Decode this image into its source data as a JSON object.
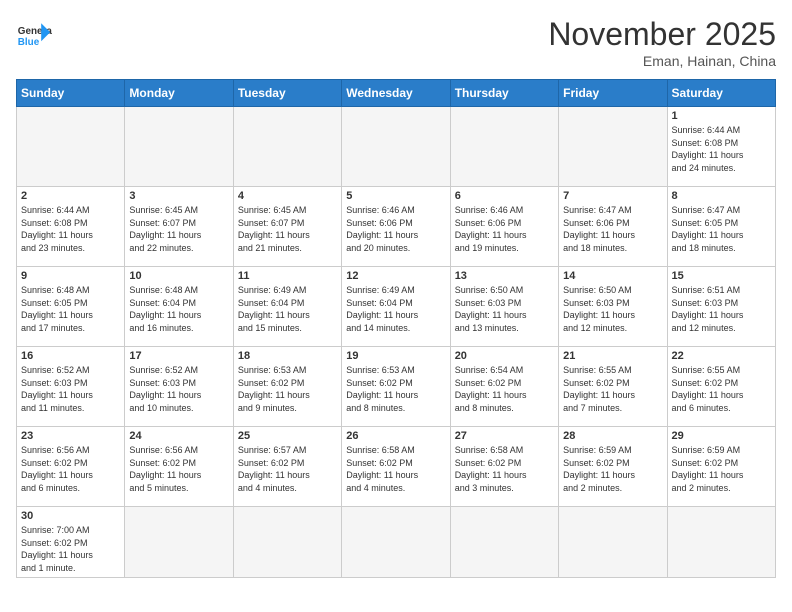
{
  "header": {
    "logo_general": "General",
    "logo_blue": "Blue",
    "month_title": "November 2025",
    "location": "Eman, Hainan, China"
  },
  "weekdays": [
    "Sunday",
    "Monday",
    "Tuesday",
    "Wednesday",
    "Thursday",
    "Friday",
    "Saturday"
  ],
  "weeks": [
    [
      {
        "day": "",
        "info": ""
      },
      {
        "day": "",
        "info": ""
      },
      {
        "day": "",
        "info": ""
      },
      {
        "day": "",
        "info": ""
      },
      {
        "day": "",
        "info": ""
      },
      {
        "day": "",
        "info": ""
      },
      {
        "day": "1",
        "info": "Sunrise: 6:44 AM\nSunset: 6:08 PM\nDaylight: 11 hours\nand 24 minutes."
      }
    ],
    [
      {
        "day": "2",
        "info": "Sunrise: 6:44 AM\nSunset: 6:08 PM\nDaylight: 11 hours\nand 23 minutes."
      },
      {
        "day": "3",
        "info": "Sunrise: 6:45 AM\nSunset: 6:07 PM\nDaylight: 11 hours\nand 22 minutes."
      },
      {
        "day": "4",
        "info": "Sunrise: 6:45 AM\nSunset: 6:07 PM\nDaylight: 11 hours\nand 21 minutes."
      },
      {
        "day": "5",
        "info": "Sunrise: 6:46 AM\nSunset: 6:06 PM\nDaylight: 11 hours\nand 20 minutes."
      },
      {
        "day": "6",
        "info": "Sunrise: 6:46 AM\nSunset: 6:06 PM\nDaylight: 11 hours\nand 19 minutes."
      },
      {
        "day": "7",
        "info": "Sunrise: 6:47 AM\nSunset: 6:06 PM\nDaylight: 11 hours\nand 18 minutes."
      },
      {
        "day": "8",
        "info": "Sunrise: 6:47 AM\nSunset: 6:05 PM\nDaylight: 11 hours\nand 18 minutes."
      }
    ],
    [
      {
        "day": "9",
        "info": "Sunrise: 6:48 AM\nSunset: 6:05 PM\nDaylight: 11 hours\nand 17 minutes."
      },
      {
        "day": "10",
        "info": "Sunrise: 6:48 AM\nSunset: 6:04 PM\nDaylight: 11 hours\nand 16 minutes."
      },
      {
        "day": "11",
        "info": "Sunrise: 6:49 AM\nSunset: 6:04 PM\nDaylight: 11 hours\nand 15 minutes."
      },
      {
        "day": "12",
        "info": "Sunrise: 6:49 AM\nSunset: 6:04 PM\nDaylight: 11 hours\nand 14 minutes."
      },
      {
        "day": "13",
        "info": "Sunrise: 6:50 AM\nSunset: 6:03 PM\nDaylight: 11 hours\nand 13 minutes."
      },
      {
        "day": "14",
        "info": "Sunrise: 6:50 AM\nSunset: 6:03 PM\nDaylight: 11 hours\nand 12 minutes."
      },
      {
        "day": "15",
        "info": "Sunrise: 6:51 AM\nSunset: 6:03 PM\nDaylight: 11 hours\nand 12 minutes."
      }
    ],
    [
      {
        "day": "16",
        "info": "Sunrise: 6:52 AM\nSunset: 6:03 PM\nDaylight: 11 hours\nand 11 minutes."
      },
      {
        "day": "17",
        "info": "Sunrise: 6:52 AM\nSunset: 6:03 PM\nDaylight: 11 hours\nand 10 minutes."
      },
      {
        "day": "18",
        "info": "Sunrise: 6:53 AM\nSunset: 6:02 PM\nDaylight: 11 hours\nand 9 minutes."
      },
      {
        "day": "19",
        "info": "Sunrise: 6:53 AM\nSunset: 6:02 PM\nDaylight: 11 hours\nand 8 minutes."
      },
      {
        "day": "20",
        "info": "Sunrise: 6:54 AM\nSunset: 6:02 PM\nDaylight: 11 hours\nand 8 minutes."
      },
      {
        "day": "21",
        "info": "Sunrise: 6:55 AM\nSunset: 6:02 PM\nDaylight: 11 hours\nand 7 minutes."
      },
      {
        "day": "22",
        "info": "Sunrise: 6:55 AM\nSunset: 6:02 PM\nDaylight: 11 hours\nand 6 minutes."
      }
    ],
    [
      {
        "day": "23",
        "info": "Sunrise: 6:56 AM\nSunset: 6:02 PM\nDaylight: 11 hours\nand 6 minutes."
      },
      {
        "day": "24",
        "info": "Sunrise: 6:56 AM\nSunset: 6:02 PM\nDaylight: 11 hours\nand 5 minutes."
      },
      {
        "day": "25",
        "info": "Sunrise: 6:57 AM\nSunset: 6:02 PM\nDaylight: 11 hours\nand 4 minutes."
      },
      {
        "day": "26",
        "info": "Sunrise: 6:58 AM\nSunset: 6:02 PM\nDaylight: 11 hours\nand 4 minutes."
      },
      {
        "day": "27",
        "info": "Sunrise: 6:58 AM\nSunset: 6:02 PM\nDaylight: 11 hours\nand 3 minutes."
      },
      {
        "day": "28",
        "info": "Sunrise: 6:59 AM\nSunset: 6:02 PM\nDaylight: 11 hours\nand 2 minutes."
      },
      {
        "day": "29",
        "info": "Sunrise: 6:59 AM\nSunset: 6:02 PM\nDaylight: 11 hours\nand 2 minutes."
      }
    ],
    [
      {
        "day": "30",
        "info": "Sunrise: 7:00 AM\nSunset: 6:02 PM\nDaylight: 11 hours\nand 1 minute."
      },
      {
        "day": "",
        "info": ""
      },
      {
        "day": "",
        "info": ""
      },
      {
        "day": "",
        "info": ""
      },
      {
        "day": "",
        "info": ""
      },
      {
        "day": "",
        "info": ""
      },
      {
        "day": "",
        "info": ""
      }
    ]
  ]
}
